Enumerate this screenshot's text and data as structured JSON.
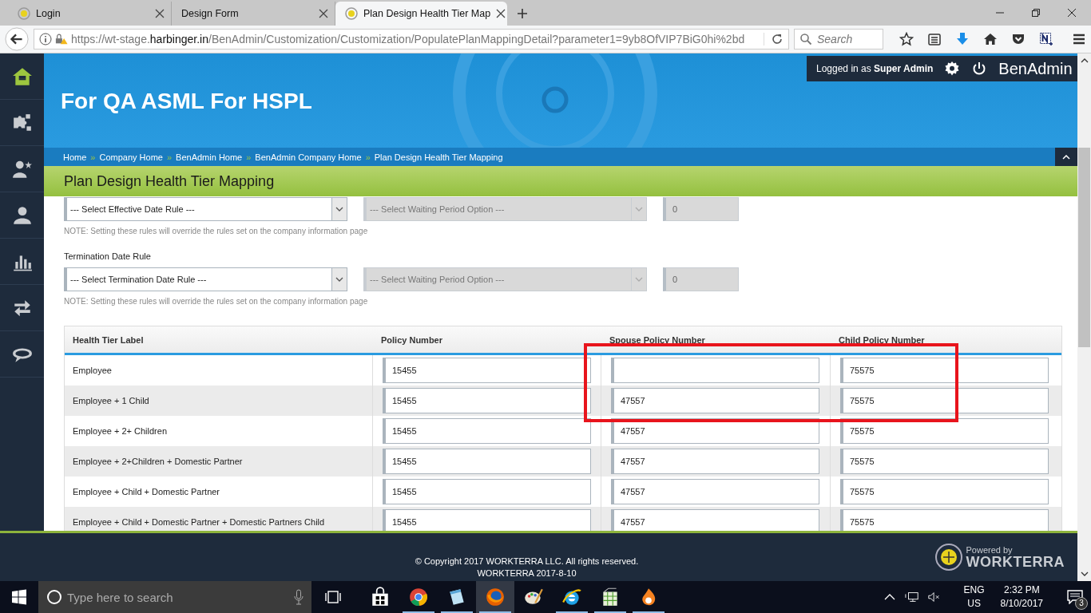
{
  "browser": {
    "tabs": [
      {
        "title": "Login",
        "favicon": true,
        "selected": false
      },
      {
        "title": "Design Form",
        "favicon": false,
        "selected": false
      },
      {
        "title": "Plan Design Health Tier Map",
        "favicon": true,
        "selected": true
      }
    ],
    "url": {
      "start": "https://wt-stage.",
      "domain": "harbinger.in",
      "path": "/BenAdmin/Customization/Customization/PopulatePlanMappingDetail?parameter1=9yb8OfVIP7BiG0hi%2bd"
    },
    "search_placeholder": "Search"
  },
  "sidebar": [
    {
      "kind": "home",
      "selected": true
    },
    {
      "kind": "puzzle",
      "selected": false
    },
    {
      "kind": "person-star",
      "selected": false
    },
    {
      "kind": "person",
      "selected": false
    },
    {
      "kind": "chart",
      "selected": false
    },
    {
      "kind": "arrows",
      "selected": false
    },
    {
      "kind": "chat",
      "selected": false
    }
  ],
  "header": {
    "company": "For QA ASML For HSPL",
    "logged_in_prefix": "Logged in as",
    "user": "Super Admin",
    "app": "BenAdmin"
  },
  "breadcrumbs": [
    {
      "text": "Home"
    },
    {
      "separator": "»",
      "text": "Company Home"
    },
    {
      "separator": "»",
      "text": "BenAdmin Home"
    },
    {
      "separator": "»",
      "text": "BenAdmin Company Home"
    },
    {
      "separator": "»",
      "text": "Plan Design Health Tier Mapping"
    }
  ],
  "page_title": "Plan Design Health Tier Mapping",
  "rules": [
    {
      "select": "--- Select Effective Date Rule ---",
      "waiting": {
        "text": "--- Select Waiting Period Option ---",
        "disabled": true
      },
      "days": {
        "value": "0",
        "disabled": true
      },
      "note": "NOTE: Setting these rules will override the rules set on the company information page"
    },
    {
      "label": "Termination Date Rule",
      "select": "--- Select Termination Date Rule ---",
      "waiting": {
        "text": "--- Select Waiting Period Option ---",
        "disabled": true
      },
      "days": {
        "value": "0",
        "disabled": true
      },
      "note": "NOTE: Setting these rules will override the rules set on the company information page"
    }
  ],
  "table": {
    "columns": [
      "Health Tier Label",
      "Policy Number",
      "Spouse Policy Number",
      "Child Policy Number"
    ],
    "rows": [
      {
        "label": "Employee",
        "policy": "15455",
        "child": "75575"
      },
      {
        "label": "Employee + 1 Child",
        "policy": "15455",
        "spouse": "47557",
        "child": "75575"
      },
      {
        "label": "Employee + 2+ Children",
        "policy": "15455",
        "spouse": "47557",
        "child": "75575"
      },
      {
        "label": "Employee + 2+Children + Domestic Partner",
        "policy": "15455",
        "spouse": "47557",
        "child": "75575"
      },
      {
        "label": "Employee + Child + Domestic Partner",
        "policy": "15455",
        "spouse": "47557",
        "child": "75575"
      },
      {
        "label": "Employee + Child + Domestic Partner + Domestic Partners Child",
        "policy": "15455",
        "spouse": "47557",
        "child": "75575"
      }
    ]
  },
  "footer": {
    "copyright": "© Copyright 2017 WORKTERRA LLC. All rights reserved.",
    "version": "WORKTERRA 2017-8-10",
    "powered_by": "Powered by",
    "brand": "WORKTERRA"
  },
  "taskbar": {
    "search_placeholder": "Type here to search",
    "apps": [
      {
        "kind": "store",
        "running": false,
        "selected": false
      },
      {
        "kind": "chrome",
        "running": true,
        "selected": false
      },
      {
        "kind": "notepad",
        "running": true,
        "selected": false
      },
      {
        "kind": "firefox",
        "running": true,
        "selected": true
      },
      {
        "kind": "paint",
        "running": false,
        "selected": false
      },
      {
        "kind": "ie",
        "running": true,
        "selected": false
      },
      {
        "kind": "sheet",
        "running": true,
        "selected": false
      },
      {
        "kind": "flame",
        "running": true,
        "selected": false
      }
    ],
    "language": "ENG",
    "region": "US",
    "time": "2:32 PM",
    "date": "8/10/2017",
    "notifications": "3"
  }
}
